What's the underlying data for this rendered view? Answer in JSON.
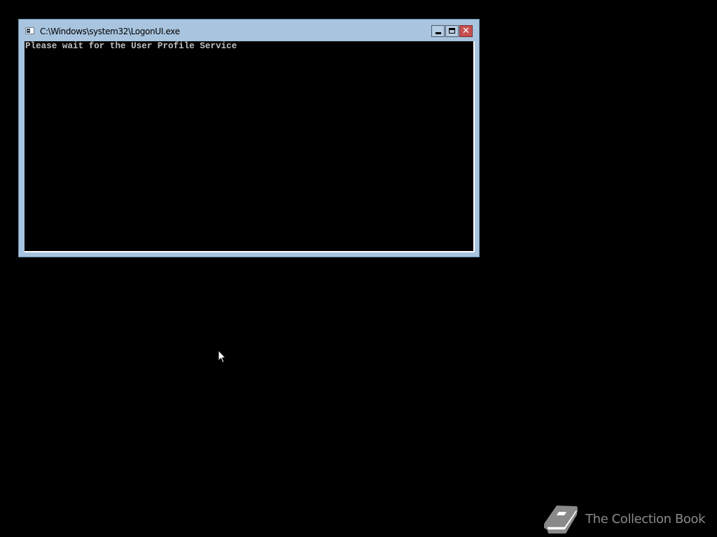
{
  "window": {
    "title": "C:\\Windows\\system32\\LogonUI.exe",
    "icon": "console-app-icon",
    "buttons": {
      "minimize_icon": "minimize-icon",
      "maximize_icon": "maximize-icon",
      "close_icon": "close-icon",
      "close_glyph": "✕"
    }
  },
  "console": {
    "lines": [
      "Please wait for the User Profile Service"
    ],
    "background": "#000000",
    "text_color": "#c0c0c0"
  },
  "watermark": {
    "text": "The Collection Book",
    "icon": "book-icon"
  },
  "colors": {
    "desktop": "#000000",
    "window_frame": "#a8c4de",
    "close_button": "#c75050"
  }
}
